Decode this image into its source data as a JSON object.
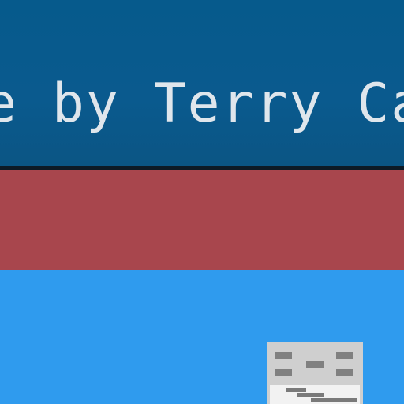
{
  "header": {
    "text": "e by Terry Cav"
  },
  "colors": {
    "header_bg": "#065a8c",
    "divider": "#0d1a26",
    "stripe": "#a8464d",
    "content_bg": "#2f9bee",
    "header_text": "#dfe6ec"
  },
  "icons": {
    "content_icon": "document-icon"
  }
}
